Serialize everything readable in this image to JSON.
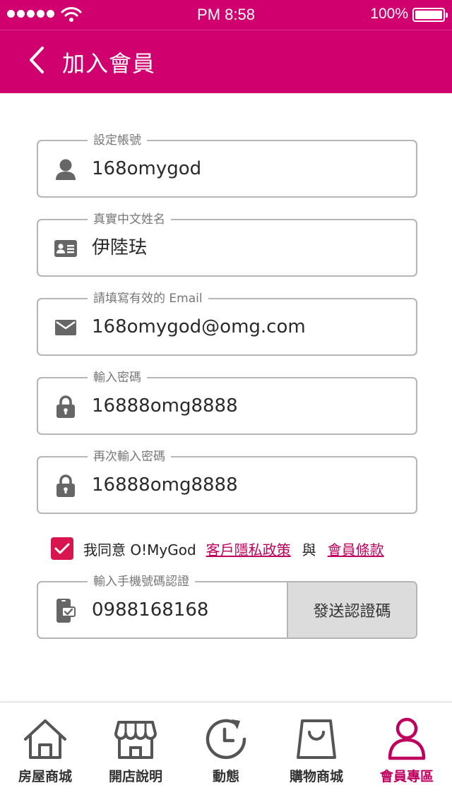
{
  "status_bar": {
    "time": "PM 8:58",
    "battery": "100%",
    "battery_level": 1.0
  },
  "header": {
    "title": "加入會員",
    "back_icon": "chevron-left-icon"
  },
  "form": {
    "account": {
      "label": "設定帳號",
      "value": "168omygod",
      "icon": "user-icon"
    },
    "name": {
      "label": "真實中文姓名",
      "value": "伊陸珐",
      "icon": "id-card-icon"
    },
    "email": {
      "label": "請填寫有效的 Email",
      "value": "168omygod@omg.com",
      "icon": "mail-icon"
    },
    "password": {
      "label": "輸入密碼",
      "value": "16888omg8888",
      "icon": "lock-icon"
    },
    "password_confirm": {
      "label": "再次輸入密碼",
      "value": "16888omg8888",
      "icon": "lock-icon"
    }
  },
  "agreement": {
    "checked": true,
    "text": "我同意 O!MyGod",
    "privacy_link": "客戶隱私政策",
    "and": "與",
    "terms_link": "會員條款"
  },
  "phone_verify": {
    "label": "輸入手機號碼認證",
    "value": "0988168168",
    "icon": "phone-check-icon",
    "button": "發送認證碼"
  },
  "tabs": [
    {
      "label": "房屋商城",
      "icon": "house-icon",
      "active": false
    },
    {
      "label": "開店說明",
      "icon": "storefront-icon",
      "active": false
    },
    {
      "label": "動態",
      "icon": "history-clock-icon",
      "active": false
    },
    {
      "label": "購物商城",
      "icon": "shopping-bag-icon",
      "active": false
    },
    {
      "label": "會員專區",
      "icon": "member-icon",
      "active": true
    }
  ],
  "colors": {
    "brand": "#d0006f",
    "checkbox": "#d8154f",
    "link": "#c0005f",
    "icon_gray": "#666666"
  }
}
